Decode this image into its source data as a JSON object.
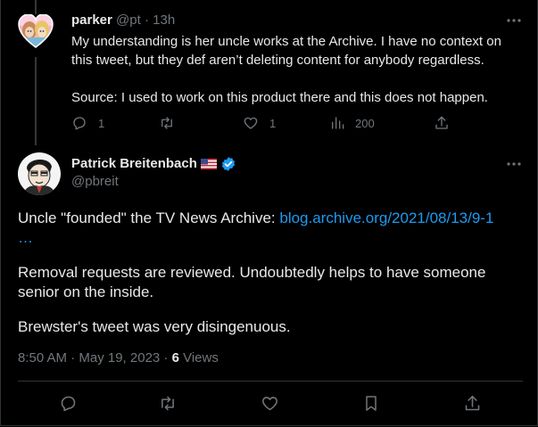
{
  "reply": {
    "display_name": "parker",
    "handle": "@pt",
    "separator": "·",
    "time": "13h",
    "paragraph_1": "My understanding is her uncle works at the Archive. I have no context on this tweet, but they def aren’t deleting content for anybody regardless.",
    "paragraph_2": "Source: I used to work on this product there and this does not happen.",
    "actions": {
      "reply_count": "1",
      "like_count": "1",
      "view_count": "200"
    }
  },
  "tweet": {
    "display_name": "Patrick Breitenbach",
    "handle": "@pbreit",
    "body_lead": "Uncle \"founded\" the TV News Archive: ",
    "link_text": "blog.archive.org/2021/08/13/9-1",
    "ellipsis": "…",
    "paragraph_2": "Removal requests are reviewed. Undoubtedly helps to have someone senior on the inside.",
    "paragraph_3": "Brewster's tweet was very disingenuous.",
    "timestamp": "8:50 AM · May 19, 2023 · ",
    "views_count": "6",
    "views_label": " Views"
  },
  "icons": {
    "more": "more-horizontal-icon",
    "reply": "reply-icon",
    "retweet": "retweet-icon",
    "like": "like-icon",
    "views": "views-icon",
    "share": "share-icon",
    "bookmark": "bookmark-icon",
    "verified": "verified-badge-icon",
    "flag": "us-flag-icon"
  },
  "colors": {
    "background": "#000000",
    "text": "#e7e9ea",
    "muted": "#71767b",
    "link": "#1d9bf0",
    "border": "#2f3336"
  }
}
